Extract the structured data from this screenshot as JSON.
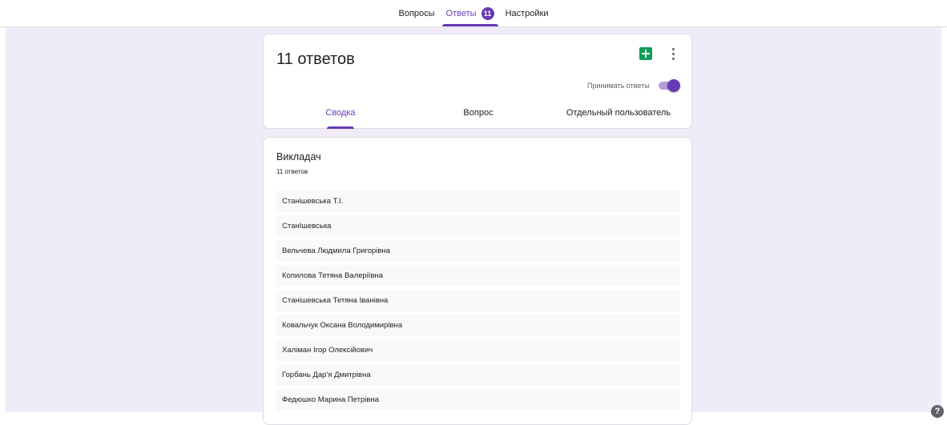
{
  "top_tabs": [
    {
      "label": "Вопросы"
    },
    {
      "label": "Ответы",
      "badge": "11"
    },
    {
      "label": "Настройки"
    }
  ],
  "summary": {
    "title": "11 ответов",
    "accept_label": "Принимать ответы",
    "accepting": true,
    "tabs": [
      {
        "label": "Сводка"
      },
      {
        "label": "Вопрос"
      },
      {
        "label": "Отдельный пользователь"
      }
    ]
  },
  "question": {
    "title": "Викладач",
    "count": "11 ответов",
    "answers": [
      "Станішевська Т.І.",
      "СтанІшевська",
      "Вельчева Людмила Григорівна",
      "Копилова Тетяна Валеріївна",
      "Станішевська Тетяна Іванівна",
      "Ковальчук Оксана Володимирівна",
      "Халіман Ігор Олексійович",
      "Горбань Дар'я Дмитрівна",
      "Федюшко Марина Петрівна"
    ]
  },
  "icons": {
    "sheets": "sheets-icon",
    "more": "more-vert-icon",
    "help": "help-icon"
  },
  "colors": {
    "accent": "#673ab7",
    "background": "#f0ebf8",
    "sheets_green": "#0f9d58"
  }
}
